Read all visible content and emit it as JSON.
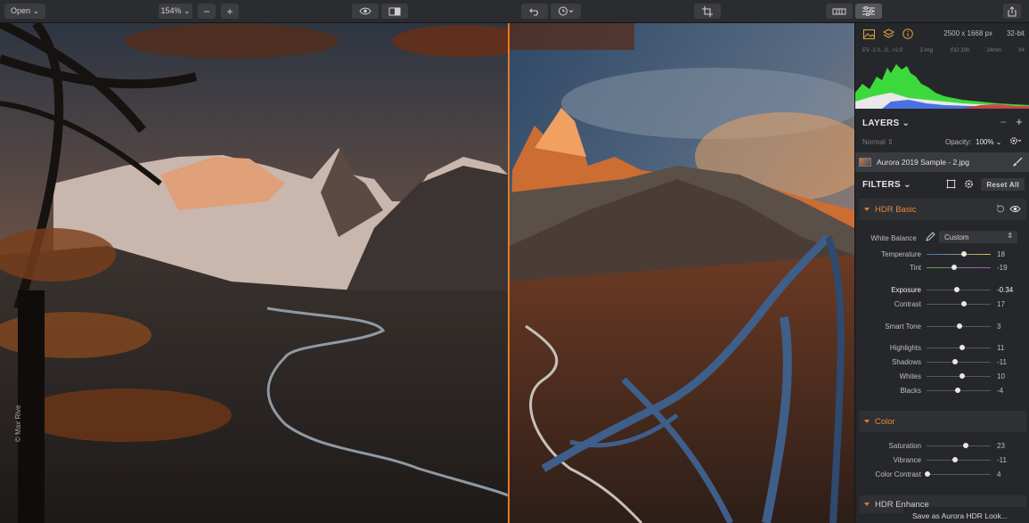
{
  "toolbar": {
    "open_label": "Open ⌄",
    "zoom_label": "154% ⌄",
    "zoom_out": "−",
    "zoom_in": "+"
  },
  "canvas": {
    "watermark": "© Max Rive"
  },
  "info": {
    "image_size": "2500 x 1668 px",
    "bit_depth": "32-bit",
    "exif": [
      "EV -2.0...0...+2.0",
      "3 img",
      "ISO 200",
      "24mm",
      "f/4"
    ]
  },
  "layers": {
    "title": "LAYERS ⌄",
    "minus": "−",
    "plus": "+",
    "blend_mode": "Normal ⇕",
    "opacity_label": "Opacity:",
    "opacity_value": "100% ⌄",
    "layer_name": "Aurora 2019 Sample - 2.jpg"
  },
  "filters": {
    "title": "FILTERS ⌄",
    "reset_label": "Reset All",
    "hdr_basic": {
      "name": "HDR Basic",
      "wb_label": "White Balance",
      "wb_value": "Custom",
      "sliders": [
        {
          "label": "Temperature",
          "value": "18",
          "pos": 0.59
        },
        {
          "label": "Tint",
          "value": "-19",
          "pos": 0.43
        },
        {
          "label": "Exposure",
          "value": "-0.34",
          "pos": 0.47
        },
        {
          "label": "Contrast",
          "value": "17",
          "pos": 0.58
        },
        {
          "label": "Smart Tone",
          "value": "3",
          "pos": 0.52
        },
        {
          "label": "Highlights",
          "value": "11",
          "pos": 0.55
        },
        {
          "label": "Shadows",
          "value": "-11",
          "pos": 0.45
        },
        {
          "label": "Whites",
          "value": "10",
          "pos": 0.55
        },
        {
          "label": "Blacks",
          "value": "-4",
          "pos": 0.48
        }
      ]
    },
    "color": {
      "name": "Color",
      "sliders": [
        {
          "label": "Saturation",
          "value": "23",
          "pos": 0.61
        },
        {
          "label": "Vibrance",
          "value": "-11",
          "pos": 0.45
        },
        {
          "label": "Color Contrast",
          "value": "4",
          "pos": 0.02
        }
      ]
    },
    "hdr_enhance": {
      "name": "HDR Enhance"
    }
  },
  "footer": {
    "save_look": "Save as Aurora HDR Look..."
  },
  "colors": {
    "accent": "#e07b2a",
    "panel_bg": "#26272a",
    "toolbar_bg": "#2b2c2f"
  },
  "icons": [
    "eye-icon",
    "compare-icon",
    "undo-icon",
    "history-icon",
    "crop-icon",
    "layers-view-icon",
    "adjust-icon",
    "share-icon",
    "image-icon",
    "layers-icon",
    "info-icon",
    "mask-icon",
    "gear-icon",
    "brush-icon",
    "reset-icon",
    "eye-icon",
    "eyedropper-icon"
  ]
}
